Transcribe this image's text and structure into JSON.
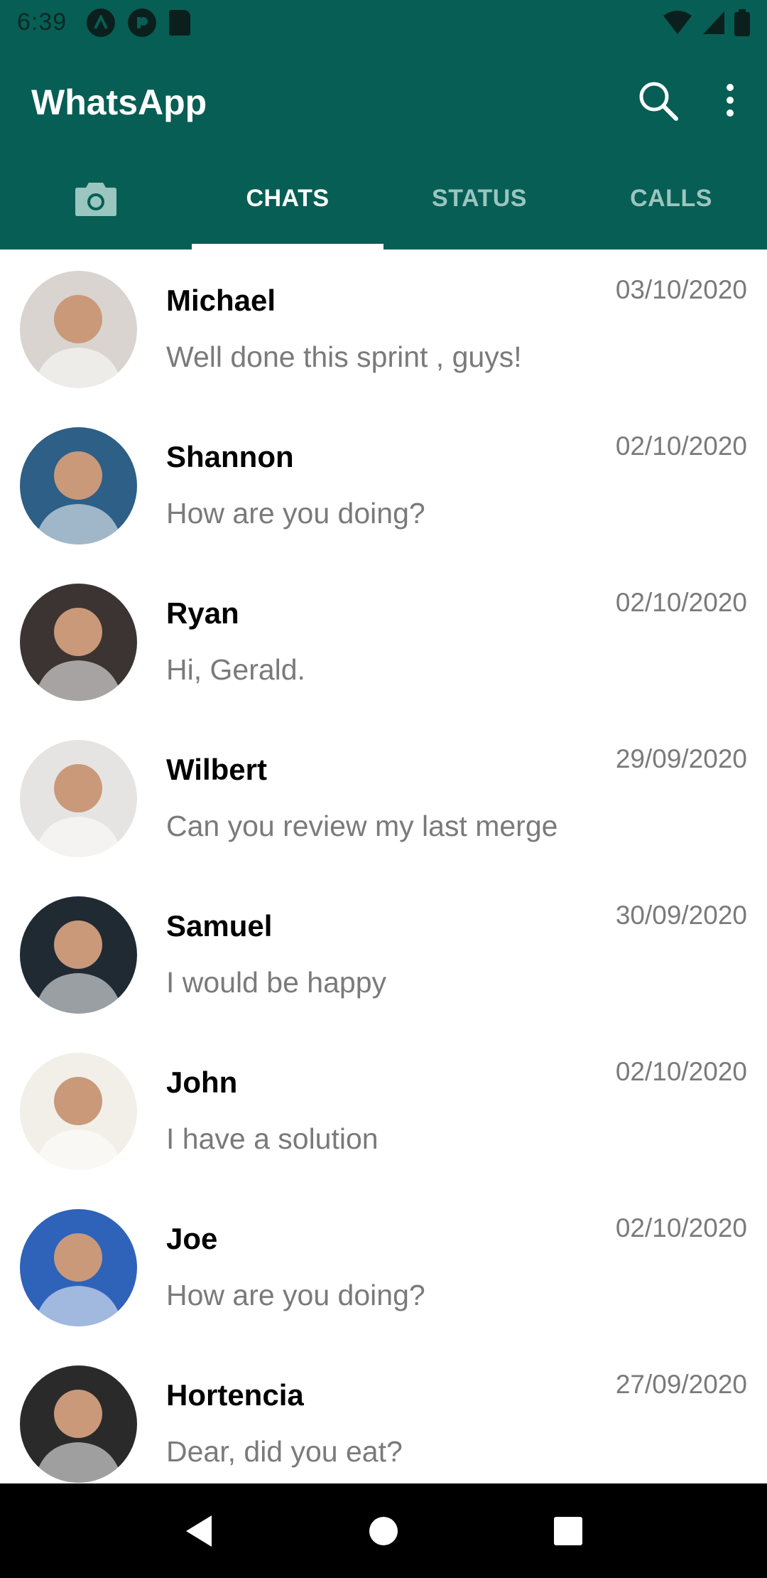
{
  "status_bar": {
    "time": "6:39",
    "left_icons": [
      "a-icon",
      "p-icon",
      "sd-card-icon"
    ],
    "right_icons": [
      "wifi-icon",
      "signal-icon",
      "battery-icon"
    ]
  },
  "app_bar": {
    "title": "WhatsApp",
    "actions": [
      "search-icon",
      "more-vert-icon"
    ]
  },
  "tabs": [
    {
      "label": "",
      "icon": "camera-icon"
    },
    {
      "label": "CHATS",
      "active": true
    },
    {
      "label": "STATUS"
    },
    {
      "label": "CALLS"
    }
  ],
  "chats": [
    {
      "name": "Michael",
      "preview": "Well done this sprint , guys!",
      "date": "03/10/2020",
      "avatar_color": "#d9d4cf"
    },
    {
      "name": "Shannon",
      "preview": "How are you doing?",
      "date": "02/10/2020",
      "avatar_color": "#2d5f87"
    },
    {
      "name": "Ryan",
      "preview": "Hi, Gerald.",
      "date": "02/10/2020",
      "avatar_color": "#3b3432"
    },
    {
      "name": "Wilbert",
      "preview": "Can you review my last merge",
      "date": "29/09/2020",
      "avatar_color": "#e6e4e2"
    },
    {
      "name": "Samuel",
      "preview": "I would be happy",
      "date": "30/09/2020",
      "avatar_color": "#1f2a33"
    },
    {
      "name": "John",
      "preview": "I have a solution",
      "date": "02/10/2020",
      "avatar_color": "#f2efe9"
    },
    {
      "name": "Joe",
      "preview": "How are you doing?",
      "date": "02/10/2020",
      "avatar_color": "#2f62b9"
    },
    {
      "name": "Hortencia",
      "preview": "Dear, did you eat?",
      "date": "27/09/2020",
      "avatar_color": "#2a2a2a"
    }
  ],
  "nav_bar": {
    "buttons": [
      "back-icon",
      "home-icon",
      "recents-icon"
    ]
  },
  "colors": {
    "primary": "#075e54",
    "tab_inactive": "#9ac6bf",
    "text_secondary": "#7a7a7a"
  }
}
